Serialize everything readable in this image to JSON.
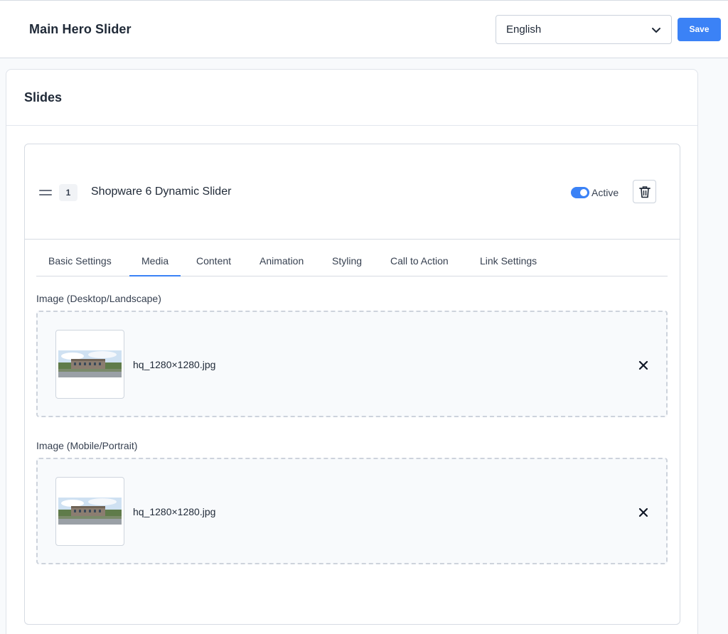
{
  "header": {
    "title": "Main Hero Slider",
    "language": "English",
    "save_label": "Save"
  },
  "panel": {
    "heading": "Slides"
  },
  "slide": {
    "number": "1",
    "name": "Shopware 6 Dynamic Slider",
    "active_label": "Active",
    "active": true
  },
  "tabs": [
    {
      "label": "Basic Settings"
    },
    {
      "label": "Media"
    },
    {
      "label": "Content"
    },
    {
      "label": "Animation"
    },
    {
      "label": "Styling"
    },
    {
      "label": "Call to Action"
    },
    {
      "label": "Link Settings"
    }
  ],
  "active_tab": "Media",
  "media": {
    "desktop": {
      "label": "Image (Desktop/Landscape)",
      "file_name": "hq_1280×1280.jpg"
    },
    "mobile": {
      "label": "Image (Mobile/Portrait)",
      "file_name": "hq_1280×1280.jpg"
    }
  },
  "colors": {
    "accent": "#3b82f6",
    "border": "#d6dbe3"
  },
  "icons": {
    "language_dropdown": "chevron-down-icon",
    "drag": "drag-handle-icon",
    "delete": "trash-icon",
    "remove": "close-icon"
  }
}
